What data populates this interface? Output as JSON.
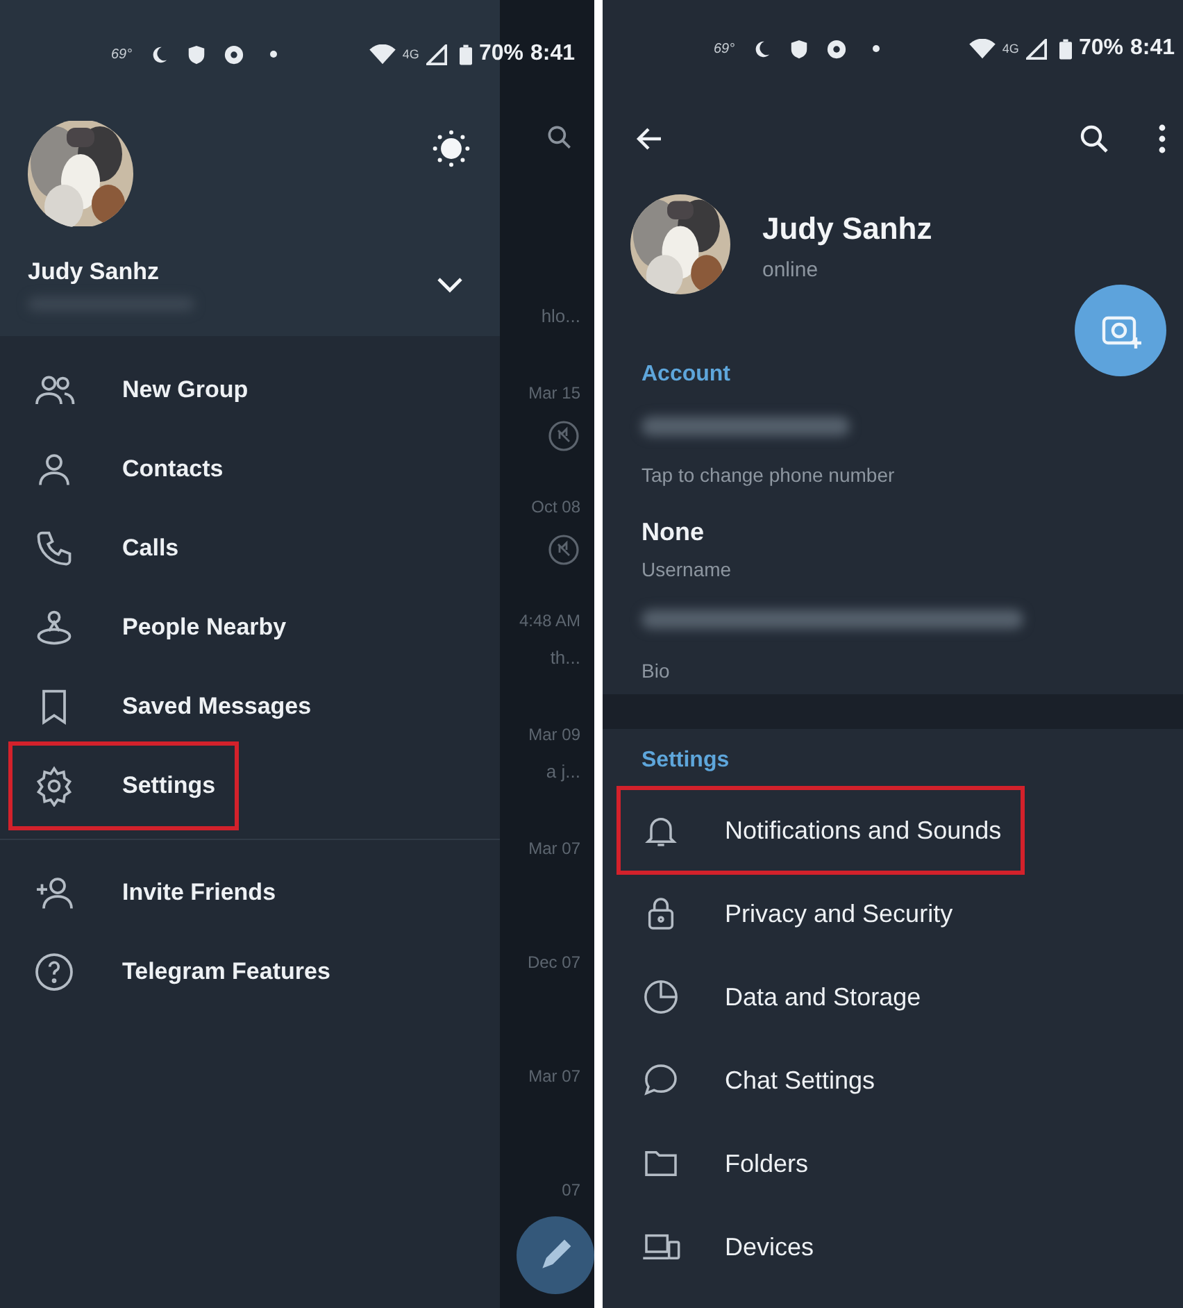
{
  "left_screen": {
    "status_bar": {
      "temperature": "69°",
      "network": "4G",
      "battery": "70%",
      "time": "8:41"
    },
    "drawer": {
      "profile_name": "Judy Sanhz",
      "accounts_expanded": false,
      "menu_groups": [
        {
          "items": [
            {
              "label": "New Group",
              "highlighted": false
            },
            {
              "label": "Contacts",
              "highlighted": false
            },
            {
              "label": "Calls",
              "highlighted": false
            },
            {
              "label": "People Nearby",
              "highlighted": false
            },
            {
              "label": "Saved Messages",
              "highlighted": false
            },
            {
              "label": "Settings",
              "highlighted": true
            }
          ]
        },
        {
          "items": [
            {
              "label": "Invite Friends",
              "highlighted": false
            },
            {
              "label": "Telegram Features",
              "highlighted": false
            }
          ]
        }
      ]
    },
    "chat_list_behind": [
      {
        "preview": "hlo..."
      },
      {
        "time": "Mar 15",
        "muted": true
      },
      {
        "time": "Oct 08",
        "muted": true
      },
      {
        "time": "4:48 AM",
        "preview": "th..."
      },
      {
        "time": "Mar 09",
        "preview": "a j..."
      },
      {
        "time": "Mar 07"
      },
      {
        "time": "Dec 07"
      },
      {
        "time": "Mar 07"
      },
      {
        "time": "07"
      }
    ]
  },
  "right_screen": {
    "status_bar": {
      "temperature": "69°",
      "network": "4G",
      "battery": "70%",
      "time": "8:41"
    },
    "profile": {
      "name": "Judy Sanhz",
      "status": "online"
    },
    "account": {
      "header": "Account",
      "rows": [
        {
          "kind": "redacted",
          "caption": "Tap to change phone number"
        },
        {
          "kind": "text",
          "value": "None",
          "caption": "Username"
        },
        {
          "kind": "redacted",
          "caption": "Bio"
        }
      ]
    },
    "settings": {
      "header": "Settings",
      "items": [
        {
          "label": "Notifications and Sounds",
          "highlighted": true
        },
        {
          "label": "Privacy and Security",
          "highlighted": false
        },
        {
          "label": "Data and Storage",
          "highlighted": false
        },
        {
          "label": "Chat Settings",
          "highlighted": false
        },
        {
          "label": "Folders",
          "highlighted": false
        },
        {
          "label": "Devices",
          "highlighted": false
        }
      ]
    }
  }
}
